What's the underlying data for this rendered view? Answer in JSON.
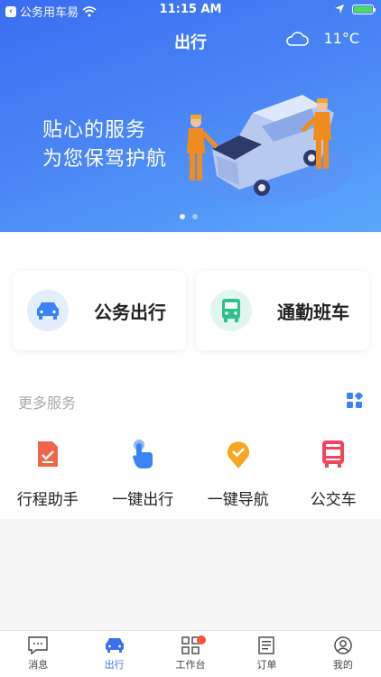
{
  "status_bar": {
    "back_app": "公务用车易",
    "time": "11:15 AM"
  },
  "header": {
    "title": "出行",
    "weather_icon": "cloud-icon",
    "temperature": "11°C"
  },
  "banner": {
    "slogan_line1": "贴心的服务",
    "slogan_line2": "为您保驾护航",
    "pages": 2,
    "active_page": 1
  },
  "main_cards": [
    {
      "label": "公务出行",
      "icon": "car-icon",
      "color": "#3b82f6"
    },
    {
      "label": "通勤班车",
      "icon": "bus-icon",
      "color": "#2ec18c"
    }
  ],
  "more_services": {
    "title": "更多服务",
    "items": [
      {
        "label": "行程助手",
        "icon": "document-check-icon",
        "color": "#f06449"
      },
      {
        "label": "一键出行",
        "icon": "tap-icon",
        "color": "#3b82f6"
      },
      {
        "label": "一键导航",
        "icon": "location-check-icon",
        "color": "#f5a623"
      },
      {
        "label": "公交车",
        "icon": "bus-icon",
        "color": "#f0455a"
      }
    ]
  },
  "tabs": [
    {
      "label": "消息",
      "icon": "message-icon",
      "active": false
    },
    {
      "label": "出行",
      "icon": "car-icon",
      "active": true
    },
    {
      "label": "工作台",
      "icon": "grid-icon",
      "active": false,
      "badge": true
    },
    {
      "label": "订单",
      "icon": "order-icon",
      "active": false
    },
    {
      "label": "我的",
      "icon": "user-icon",
      "active": false
    }
  ]
}
